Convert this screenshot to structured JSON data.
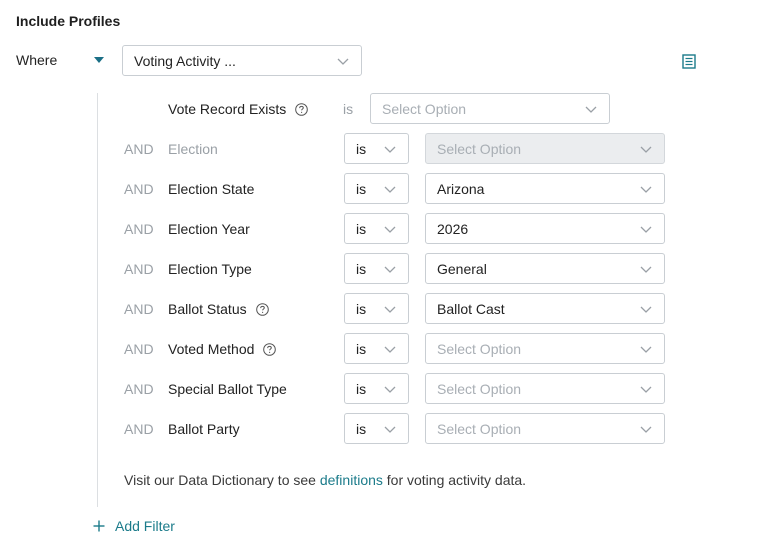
{
  "header": {
    "title": "Include Profiles"
  },
  "where": {
    "label": "Where",
    "category_value": "Voting Activity ..."
  },
  "icons": {
    "caret": "caret-down-icon",
    "chevron": "chevron-down-icon",
    "help": "question-circle-icon",
    "doc": "document-list-icon",
    "add": "plus-icon"
  },
  "first_row": {
    "field": "Vote Record Exists",
    "operator": "is",
    "value_placeholder": "Select Option"
  },
  "rows": [
    {
      "conj": "AND",
      "field": "Election",
      "operator": "is",
      "value": "Select Option"
    },
    {
      "conj": "AND",
      "field": "Election State",
      "operator": "is",
      "value": "Arizona"
    },
    {
      "conj": "AND",
      "field": "Election Year",
      "operator": "is",
      "value": "2026"
    },
    {
      "conj": "AND",
      "field": "Election Type",
      "operator": "is",
      "value": "General"
    },
    {
      "conj": "AND",
      "field": "Ballot Status",
      "operator": "is",
      "value": "Ballot Cast"
    },
    {
      "conj": "AND",
      "field": "Voted Method",
      "operator": "is",
      "value": "Select Option"
    },
    {
      "conj": "AND",
      "field": "Special Ballot Type",
      "operator": "is",
      "value": "Select Option"
    },
    {
      "conj": "AND",
      "field": "Ballot Party",
      "operator": "is",
      "value": "Select Option"
    }
  ],
  "note": {
    "prefix": "Visit our Data Dictionary to see ",
    "link": "definitions",
    "suffix": " for voting activity data."
  },
  "add_filter": {
    "label": "Add Filter"
  },
  "colors": {
    "accent": "#1b7b8a",
    "border": "#c9ced3",
    "muted": "#9aa0a6"
  }
}
